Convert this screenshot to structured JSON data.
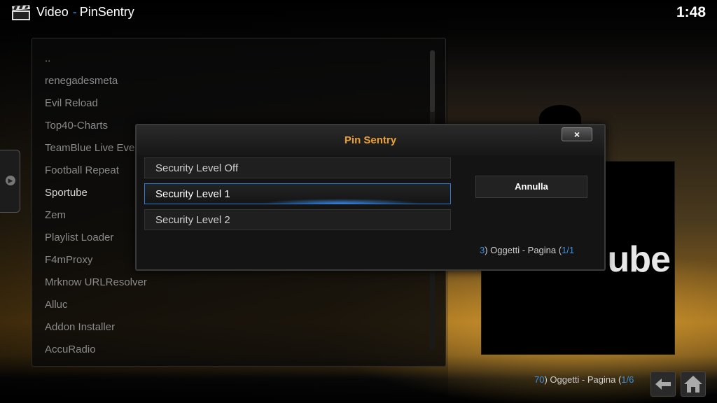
{
  "header": {
    "app_icon": "clapperboard-icon",
    "section": "Video",
    "separator": "-",
    "addon": "PinSentry",
    "clock": "1:48"
  },
  "sidebar_toggle": {
    "icon": "arrow-right-icon"
  },
  "file_list": {
    "items": [
      "..",
      "renegadesmeta",
      "Evil Reload",
      "Top40-Charts",
      "TeamBlue Live Eve",
      "Football Repeat",
      "Sportube",
      "Zem",
      "Playlist Loader",
      "F4mProxy",
      "Mrknow URLResolver",
      "Alluc",
      "Addon Installer",
      "AccuRadio"
    ],
    "highlighted_index": 6
  },
  "poster": {
    "logo_text": "ube"
  },
  "footer": {
    "count": "70",
    "mid": ") Oggetti - Pagina (",
    "page": "1/6"
  },
  "nav": {
    "back_icon": "back-arrow-icon",
    "home_icon": "home-icon"
  },
  "dialog": {
    "title": "Pin Sentry",
    "close_label": "×",
    "options": [
      "Security Level Off",
      "Security Level 1",
      "Security Level 2"
    ],
    "selected_index": 1,
    "cancel_label": "Annulla",
    "footer": {
      "count": "3",
      "mid": ") Oggetti - Pagina (",
      "page": "1/1"
    }
  },
  "colors": {
    "accent": "#3d8fe0",
    "dialog_title": "#eba138"
  }
}
